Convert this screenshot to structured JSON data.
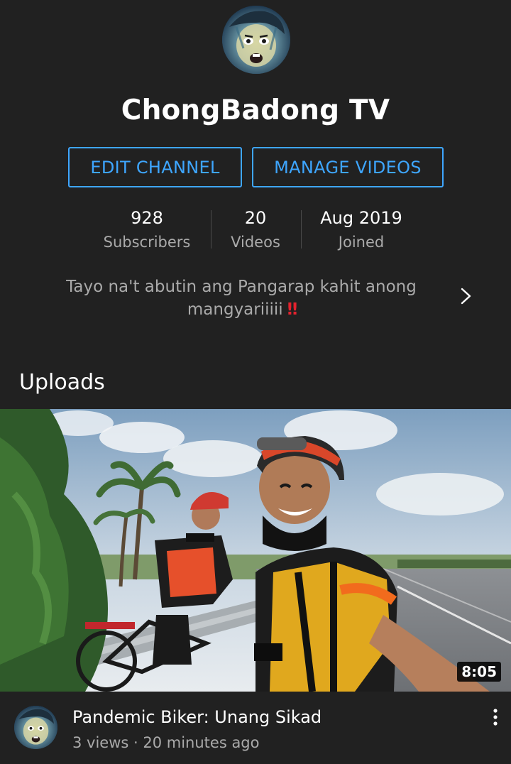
{
  "channel": {
    "name": "ChongBadong TV",
    "avatar_icon": "channel-avatar-face"
  },
  "actions": {
    "edit_label": "EDIT CHANNEL",
    "manage_label": "MANAGE VIDEOS"
  },
  "stats": [
    {
      "value": "928",
      "label": "Subscribers"
    },
    {
      "value": "20",
      "label": "Videos"
    },
    {
      "value": "Aug 2019",
      "label": "Joined"
    }
  ],
  "description": {
    "text": "Tayo na't abutin ang Pangarap kahit anong mangyariiiii",
    "emoji": "‼"
  },
  "uploads": {
    "section_title": "Uploads",
    "videos": [
      {
        "title": "Pandemic Biker: Unang Sikad",
        "meta": "3 views · 20 minutes ago",
        "duration": "8:05"
      }
    ]
  },
  "colors": {
    "background": "#212121",
    "accent": "#3ea6ff",
    "secondary_text": "#aaaaaa",
    "emoji_red": "#e3222e"
  }
}
